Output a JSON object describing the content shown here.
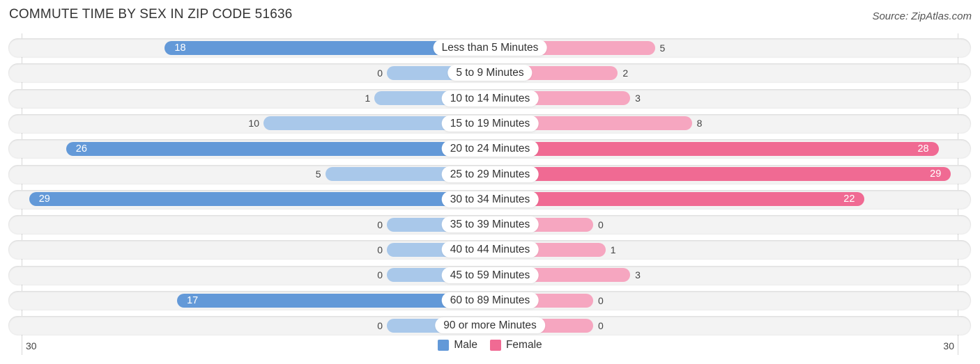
{
  "chart_data": {
    "type": "bar",
    "orientation": "horizontal-diverging",
    "title": "COMMUTE TIME BY SEX IN ZIP CODE 51636",
    "source": "Source: ZipAtlas.com",
    "categories": [
      "Less than 5 Minutes",
      "5 to 9 Minutes",
      "10 to 14 Minutes",
      "15 to 19 Minutes",
      "20 to 24 Minutes",
      "25 to 29 Minutes",
      "30 to 34 Minutes",
      "35 to 39 Minutes",
      "40 to 44 Minutes",
      "45 to 59 Minutes",
      "60 to 89 Minutes",
      "90 or more Minutes"
    ],
    "series": [
      {
        "name": "Male",
        "color": "#6399d8",
        "values": [
          18,
          0,
          1,
          10,
          26,
          5,
          29,
          0,
          0,
          0,
          17,
          0
        ]
      },
      {
        "name": "Female",
        "color": "#f06a93",
        "values": [
          5,
          2,
          3,
          8,
          28,
          29,
          22,
          0,
          1,
          3,
          0,
          0
        ]
      }
    ],
    "axis": {
      "left_label": "30",
      "right_label": "30",
      "max": 30
    },
    "legend": {
      "position": "bottom-center",
      "items": [
        "Male",
        "Female"
      ]
    }
  }
}
